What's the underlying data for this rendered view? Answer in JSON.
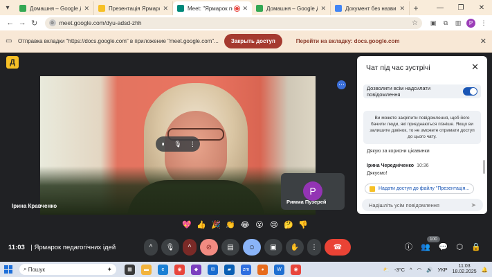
{
  "browser": {
    "tabs": [
      {
        "label": "Домашня – Google Диск",
        "favicon_color": "#34a853"
      },
      {
        "label": "Презентація Ярмарок п",
        "favicon_color": "#f6c026"
      },
      {
        "label": "Meet: \"Ярмарок педагогі",
        "favicon_color": "#00897b"
      },
      {
        "label": "Домашня – Google Диск",
        "favicon_color": "#34a853"
      },
      {
        "label": "Документ без назви - Goo",
        "favicon_color": "#4285f4"
      }
    ],
    "url": "meet.google.com/dyu-adsd-zhh"
  },
  "sharebar": {
    "text": "Отправка вкладки \"https://docs.google.com\" в приложение \"meet.google.com\"...",
    "stop_label": "Закрыть доступ",
    "switch_label": "Перейти на вкладку: docs.google.com"
  },
  "meet": {
    "logo_letter": "Д",
    "main_participant": "Ірина Кравченко",
    "tile_participant": {
      "initial": "Р",
      "name": "Римма Пузерей"
    },
    "chat": {
      "title": "Чат під час зустрічі",
      "allow_label": "Дозволити всім надсилати повідомлення",
      "info": "Ви можете закріпити повідомлення, щоб його бачили люди, які приєднаються пізніше. Якщо ви залишите дзвінок, то не зможете отримати доступ до цього чату.",
      "message1": "Дякую за корисни цікавинки",
      "author": "Ірина Чередніченко",
      "author_time": "10:36",
      "message2": "Дякуємо!",
      "share_chip": "Надати доступ до файлу \"Презентація...",
      "input_placeholder": "Надішліть усім повідомлення"
    },
    "reactions": [
      "💖",
      "👍",
      "🎉",
      "👏",
      "😂",
      "😮",
      "😢",
      "🤔",
      "👎"
    ],
    "time": "11:03",
    "meeting_title": "Ярмарок педагогічних ідей",
    "participant_count": "100"
  },
  "taskbar": {
    "search_placeholder": "Пошук",
    "weather": "-3°C",
    "lang": "УКР",
    "time": "11:03",
    "date": "18.02.2025"
  }
}
